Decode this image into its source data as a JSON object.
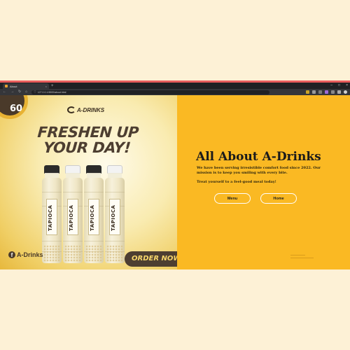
{
  "browser": {
    "tab_title": "About",
    "tab_close": "×",
    "new_tab": "+",
    "window_controls": [
      "–",
      "□",
      "×"
    ],
    "nav": {
      "back": "←",
      "forward": "→",
      "reload": "↻",
      "home": "⌂"
    },
    "url": "127.0.0.1:5500/about.html",
    "extensions": [
      "ext-1",
      "ext-2",
      "ext-3",
      "ext-4",
      "ext-5",
      "ext-6",
      "profile"
    ]
  },
  "hero": {
    "badge": "60",
    "logo_text": "A-DRINKS",
    "headline_line1": "FRESHEN UP",
    "headline_line2": "YOUR DAY!",
    "bottle_label": "TAPIOCA",
    "bottle_count": 4,
    "facebook_icon": "f",
    "facebook_label": "A-Drinks",
    "order_button": "ORDER NOW!"
  },
  "about": {
    "title": "All About A-Drinks",
    "paragraph1": "We have been serving irresistible comfort food since 2022. Our mission is to keep you smiling with every bite.",
    "paragraph2": "Treat yourself to a feel-good meal today!",
    "menu_button": "Menu",
    "home_button": "Home"
  },
  "colors": {
    "about_bg": "#fab923",
    "hero_dark": "#4d3e31",
    "page_bg": "#fdf1d6",
    "browser_accent": "#e85d5d"
  }
}
